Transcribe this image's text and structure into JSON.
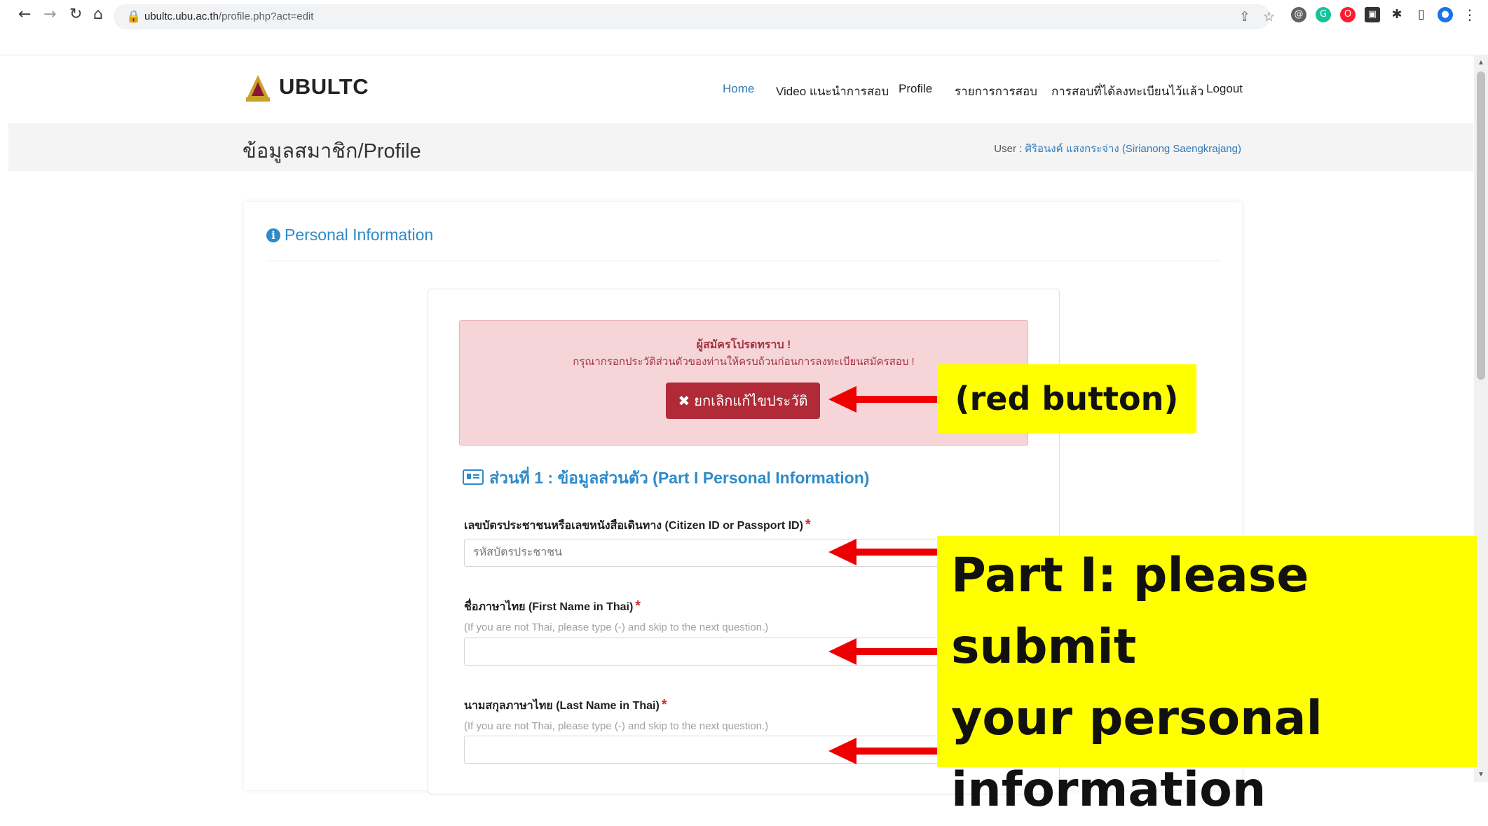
{
  "browser": {
    "url_domain": "ubultc.ubu.ac.th",
    "url_path": "/profile.php?act=edit"
  },
  "site": {
    "brand": "UBULTC",
    "menu": [
      "Home",
      "Video แนะนำการสอบ",
      "Profile",
      "รายการการสอบ",
      "การสอบที่ได้ลงทะเบียนไว้แล้ว",
      "Logout"
    ],
    "page_title": "ข้อมูลสมาชิก/Profile",
    "user_label": "User :",
    "user_name": "ศิริอนงค์ แสงกระจ่าง (Sirianong Saengkrajang)"
  },
  "section": {
    "title": "Personal Information"
  },
  "alert": {
    "title": "ผู้สมัครโปรดทราบ !",
    "message": "กรุณากรอกประวัติส่วนตัวของท่านให้ครบถ้วนก่อนการลงทะเบียนสมัครสอบ !",
    "button": "ยกเลิกแก้ไขประวัติ"
  },
  "part1": {
    "title": "ส่วนที่ 1 : ข้อมูลส่วนตัว (Part I Personal Information)",
    "fields": [
      {
        "label": "เลขบัตรประชาชนหรือเลขหนังสือเดินทาง (Citizen ID or Passport ID)",
        "hint": "",
        "placeholder": "รหัสบัตรประชาชน",
        "value": ""
      },
      {
        "label": "ชื่อภาษาไทย (First Name in Thai)",
        "hint": "(If you are not Thai, please type (-) and skip to the next question.)",
        "placeholder": "",
        "value": ""
      },
      {
        "label": "นามสกุลภาษาไทย (Last Name in Thai)",
        "hint": "(If you are not Thai, please type (-) and skip to the next question.)",
        "placeholder": "",
        "value": ""
      }
    ],
    "required_mark": "*"
  },
  "annotations": {
    "red_button_note": "(red button)",
    "part1_note_line1": "Part I: please submit",
    "part1_note_line2": "your personal",
    "part1_note_line3": "information"
  },
  "colors": {
    "link": "#337ab7",
    "accent": "#2e8bc9",
    "danger_button": "#b02a37",
    "alert_bg": "#f6d5d9",
    "callout_bg": "#ffff00",
    "arrow": "#ee0000"
  }
}
